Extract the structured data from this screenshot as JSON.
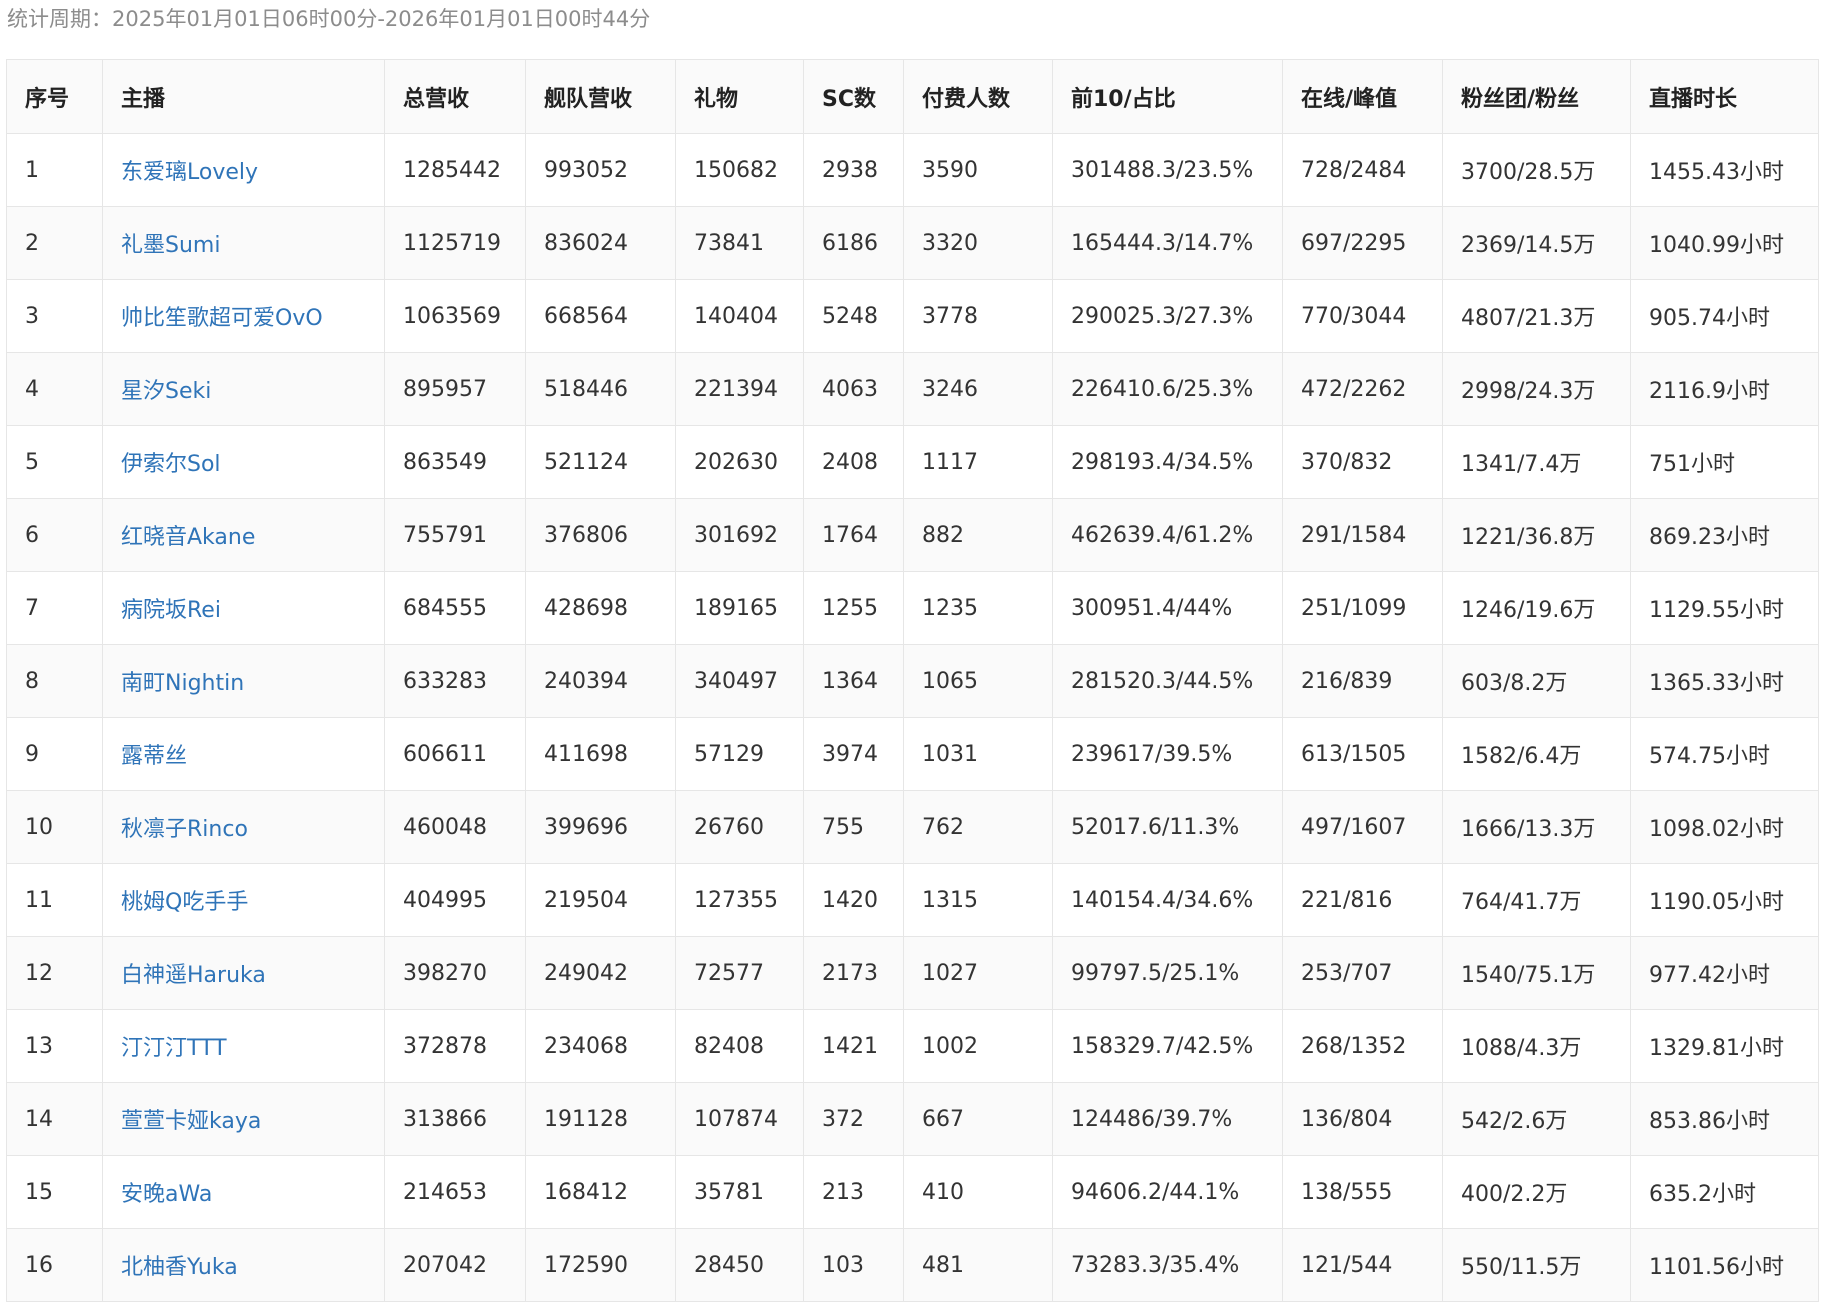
{
  "period": "统计周期：2025年01月01日06时00分-2026年01月01日00时44分",
  "colors": {
    "link": "#2f74b8",
    "header_bg": "#fafafa",
    "border": "#e6e6e6",
    "muted_text": "#8c8c8c"
  },
  "table": {
    "headers": [
      "序号",
      "主播",
      "总营收",
      "舰队营收",
      "礼物",
      "SC数",
      "付费人数",
      "前10/占比",
      "在线/峰值",
      "粉丝团/粉丝",
      "直播时长"
    ],
    "rows": [
      [
        "1",
        "东爱璃Lovely",
        "1285442",
        "993052",
        "150682",
        "2938",
        "3590",
        "301488.3/23.5%",
        "728/2484",
        "3700/28.5万",
        "1455.43小时"
      ],
      [
        "2",
        "礼墨Sumi",
        "1125719",
        "836024",
        "73841",
        "6186",
        "3320",
        "165444.3/14.7%",
        "697/2295",
        "2369/14.5万",
        "1040.99小时"
      ],
      [
        "3",
        "帅比笙歌超可爱OvO",
        "1063569",
        "668564",
        "140404",
        "5248",
        "3778",
        "290025.3/27.3%",
        "770/3044",
        "4807/21.3万",
        "905.74小时"
      ],
      [
        "4",
        "星汐Seki",
        "895957",
        "518446",
        "221394",
        "4063",
        "3246",
        "226410.6/25.3%",
        "472/2262",
        "2998/24.3万",
        "2116.9小时"
      ],
      [
        "5",
        "伊索尔Sol",
        "863549",
        "521124",
        "202630",
        "2408",
        "1117",
        "298193.4/34.5%",
        "370/832",
        "1341/7.4万",
        "751小时"
      ],
      [
        "6",
        "红晓音Akane",
        "755791",
        "376806",
        "301692",
        "1764",
        "882",
        "462639.4/61.2%",
        "291/1584",
        "1221/36.8万",
        "869.23小时"
      ],
      [
        "7",
        "病院坂Rei",
        "684555",
        "428698",
        "189165",
        "1255",
        "1235",
        "300951.4/44%",
        "251/1099",
        "1246/19.6万",
        "1129.55小时"
      ],
      [
        "8",
        "南町Nightin",
        "633283",
        "240394",
        "340497",
        "1364",
        "1065",
        "281520.3/44.5%",
        "216/839",
        "603/8.2万",
        "1365.33小时"
      ],
      [
        "9",
        "露蒂丝",
        "606611",
        "411698",
        "57129",
        "3974",
        "1031",
        "239617/39.5%",
        "613/1505",
        "1582/6.4万",
        "574.75小时"
      ],
      [
        "10",
        "秋凛子Rinco",
        "460048",
        "399696",
        "26760",
        "755",
        "762",
        "52017.6/11.3%",
        "497/1607",
        "1666/13.3万",
        "1098.02小时"
      ],
      [
        "11",
        "桃姆Q吃手手",
        "404995",
        "219504",
        "127355",
        "1420",
        "1315",
        "140154.4/34.6%",
        "221/816",
        "764/41.7万",
        "1190.05小时"
      ],
      [
        "12",
        "白神遥Haruka",
        "398270",
        "249042",
        "72577",
        "2173",
        "1027",
        "99797.5/25.1%",
        "253/707",
        "1540/75.1万",
        "977.42小时"
      ],
      [
        "13",
        "汀汀汀TTT",
        "372878",
        "234068",
        "82408",
        "1421",
        "1002",
        "158329.7/42.5%",
        "268/1352",
        "1088/4.3万",
        "1329.81小时"
      ],
      [
        "14",
        "萱萱卡娅kaya",
        "313866",
        "191128",
        "107874",
        "372",
        "667",
        "124486/39.7%",
        "136/804",
        "542/2.6万",
        "853.86小时"
      ],
      [
        "15",
        "安晚aWa",
        "214653",
        "168412",
        "35781",
        "213",
        "410",
        "94606.2/44.1%",
        "138/555",
        "400/2.2万",
        "635.2小时"
      ],
      [
        "16",
        "北柚香Yuka",
        "207042",
        "172590",
        "28450",
        "103",
        "481",
        "73283.3/35.4%",
        "121/544",
        "550/11.5万",
        "1101.56小时"
      ]
    ]
  }
}
